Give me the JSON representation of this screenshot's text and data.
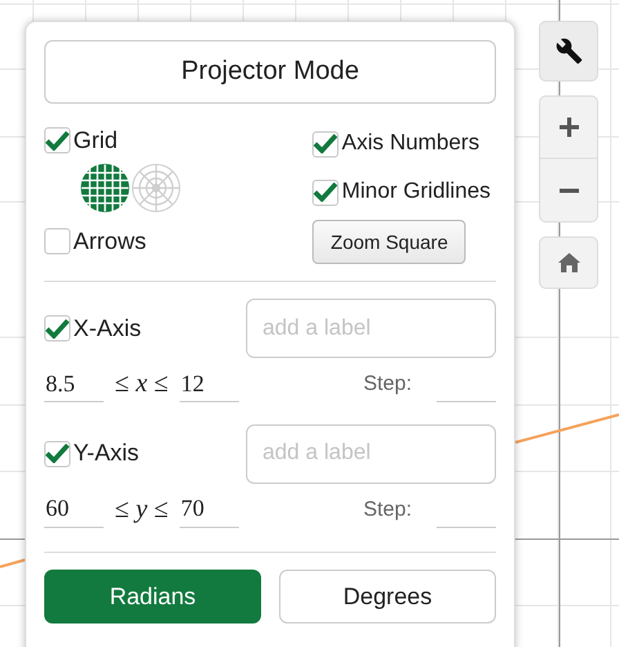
{
  "projector_mode": {
    "label": "Projector Mode"
  },
  "grid": {
    "label": "Grid",
    "checked": true,
    "styles": [
      {
        "kind": "cartesian",
        "selected": true
      },
      {
        "kind": "polar",
        "selected": false
      }
    ]
  },
  "arrows": {
    "label": "Arrows",
    "checked": false
  },
  "axis_numbers": {
    "label": "Axis Numbers",
    "checked": true
  },
  "minor_gridlines": {
    "label": "Minor Gridlines",
    "checked": true
  },
  "zoom_square": {
    "label": "Zoom Square"
  },
  "axes": [
    {
      "label": "X-Axis",
      "checked": true,
      "placeholder": "add a label",
      "min": "8.5",
      "op_low": "≤",
      "variable": "x",
      "op_high": "≤",
      "max": "12",
      "step_label": "Step:"
    },
    {
      "label": "Y-Axis",
      "checked": true,
      "placeholder": "add a label",
      "min": "60",
      "op_low": "≤",
      "variable": "y",
      "op_high": "≤",
      "max": "70",
      "step_label": "Step:"
    }
  ],
  "angle_units": [
    {
      "label": "Radians",
      "selected": true
    },
    {
      "label": "Degrees",
      "selected": false
    }
  ]
}
